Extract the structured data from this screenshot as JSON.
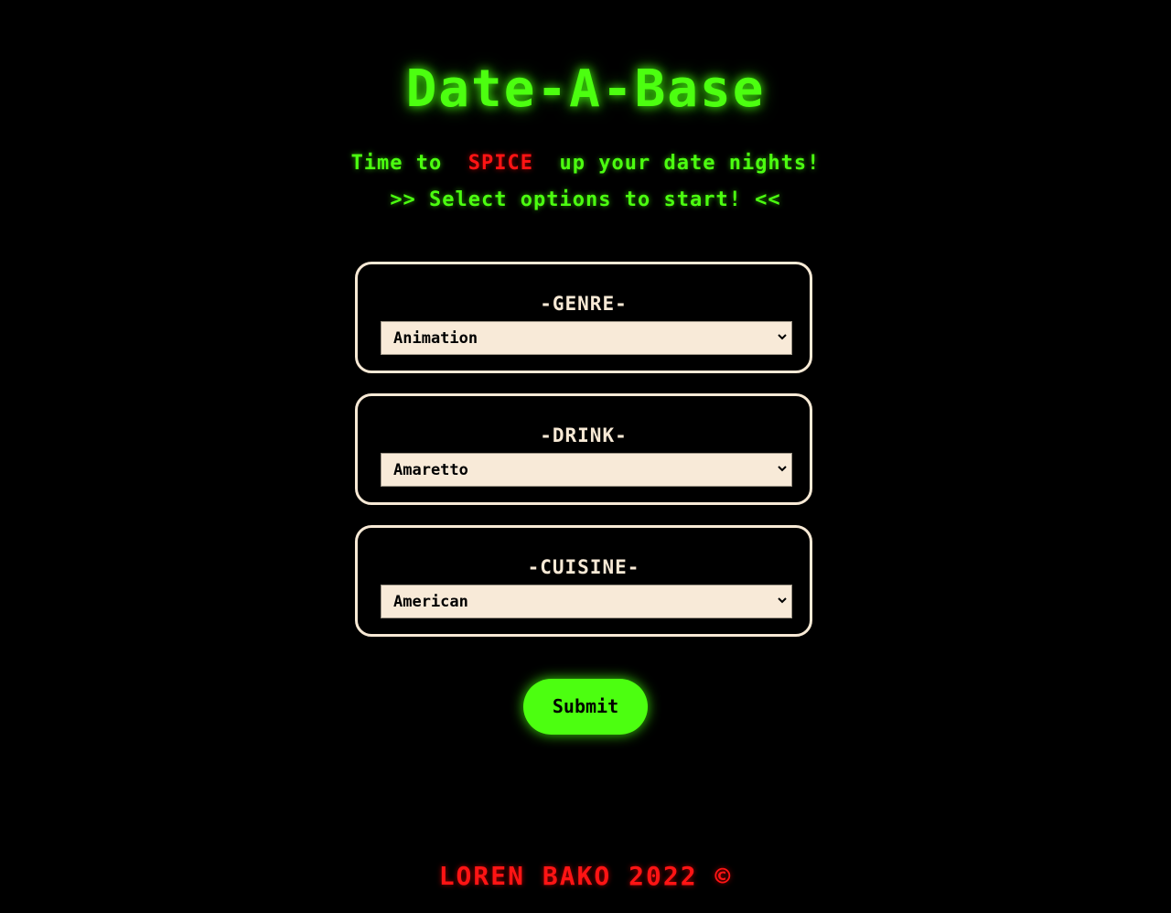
{
  "header": {
    "title": "Date-A-Base",
    "tagline_before": "Time to ",
    "tagline_highlight": "SPICE",
    "tagline_after": " up your date nights!",
    "instruction": ">> Select options to start! <<"
  },
  "form": {
    "genre": {
      "label": "-GENRE-",
      "selected": "Animation"
    },
    "drink": {
      "label": "-DRINK-",
      "selected": "Amaretto"
    },
    "cuisine": {
      "label": "-CUISINE-",
      "selected": "American"
    },
    "submit_label": "Submit"
  },
  "footer": {
    "text": "LOREN BAKO 2022 ©"
  },
  "colors": {
    "accent_green": "#4cff10",
    "highlight_red": "#ff1414",
    "card_border": "#f7e9d5",
    "select_bg": "#f8ead8",
    "background": "#000000"
  },
  "icons": {
    "select_arrow": "chevron-down-icon"
  }
}
